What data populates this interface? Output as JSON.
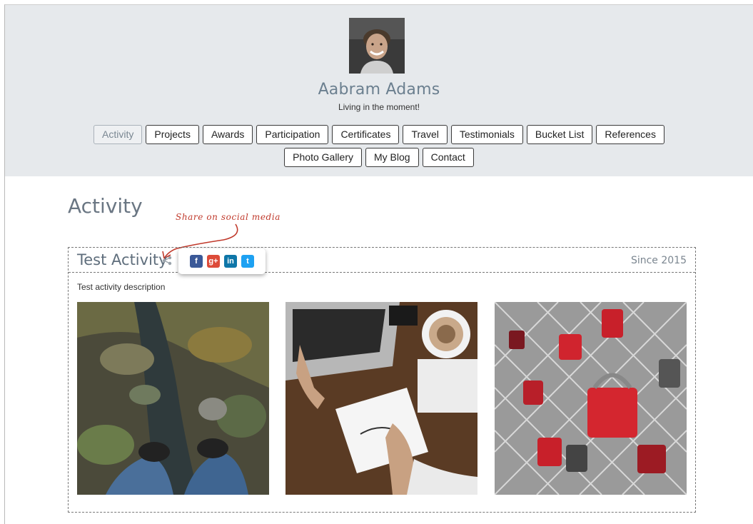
{
  "profile": {
    "name": "Aabram Adams",
    "tagline": "Living in the moment!"
  },
  "nav": {
    "row1": [
      "Activity",
      "Projects",
      "Awards",
      "Participation",
      "Certificates",
      "Travel",
      "Testimonials",
      "Bucket List",
      "References"
    ],
    "row2": [
      "Photo Gallery",
      "My Blog",
      "Contact"
    ],
    "active": "Activity"
  },
  "page": {
    "title": "Activity",
    "hint": "Share on social media"
  },
  "activity": {
    "title": "Test Activity",
    "since": "Since 2015",
    "description": "Test activity description",
    "share": {
      "facebook": "f",
      "googleplus": "g+",
      "linkedin": "in",
      "twitter": "t"
    },
    "photos": [
      "rocky-stream-feet-photo",
      "laptop-lettering-desk-photo",
      "love-locks-fence-photo"
    ]
  },
  "colors": {
    "header_bg": "#e6e9ec",
    "title": "#6a7683",
    "hint": "#c0392b",
    "facebook": "#3b5998",
    "googleplus": "#dd4b39",
    "linkedin": "#0e76a8",
    "twitter": "#1da1f2"
  }
}
